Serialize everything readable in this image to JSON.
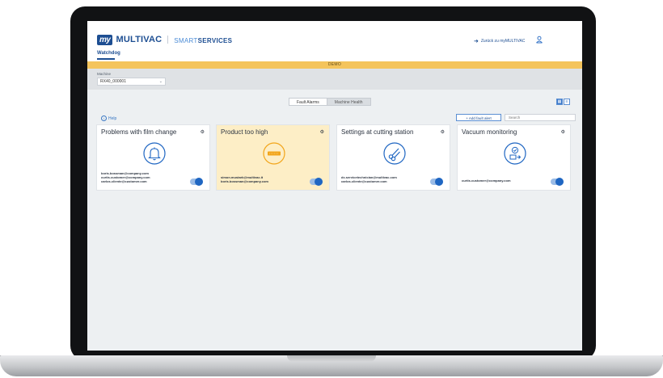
{
  "brand": {
    "logo_my": "my",
    "logo_name": "MULTIVAC",
    "logo_smart": "SMART",
    "logo_services": "SERVICES"
  },
  "header": {
    "back_link": "Zurück zu myMULTIVAC",
    "tab": "Watchdog"
  },
  "demo_banner": "DEMO",
  "machine": {
    "label": "Machine",
    "value": "RX40_000001"
  },
  "view_tabs": [
    "Fault Alarms",
    "Machine Health"
  ],
  "toolbar": {
    "help": "Help",
    "add_fault_alert": "+ Add fault alert",
    "search_placeholder": "Search"
  },
  "cards": [
    {
      "title": "Problems with film change",
      "icon": "bell-icon",
      "highlighted": false,
      "emails": [
        "boris.bossman@company.com",
        "curtis.customer@company.com",
        "carlos.cliente@customer.com"
      ],
      "enabled": true
    },
    {
      "title": "Product too high",
      "icon": "height-warning-icon",
      "highlighted": true,
      "emails": [
        "simon.mustark@multivac.it",
        "boris.bossman@company.com"
      ],
      "enabled": true
    },
    {
      "title": "Settings at cutting station",
      "icon": "scissors-icon",
      "highlighted": false,
      "emails": [
        "dc.servicetechnician@multivac.com",
        "carlos.cliente@customer.com"
      ],
      "enabled": true
    },
    {
      "title": "Vacuum monitoring",
      "icon": "vacuum-check-icon",
      "highlighted": false,
      "emails": [
        "curtis.customer@company.com"
      ],
      "enabled": true
    }
  ],
  "colors": {
    "brand_blue": "#1d4e92",
    "accent_blue": "#3b78c9",
    "demo_yellow": "#f4c45c",
    "highlight_card": "#fdeec6",
    "warning_orange": "#f2a51a"
  }
}
